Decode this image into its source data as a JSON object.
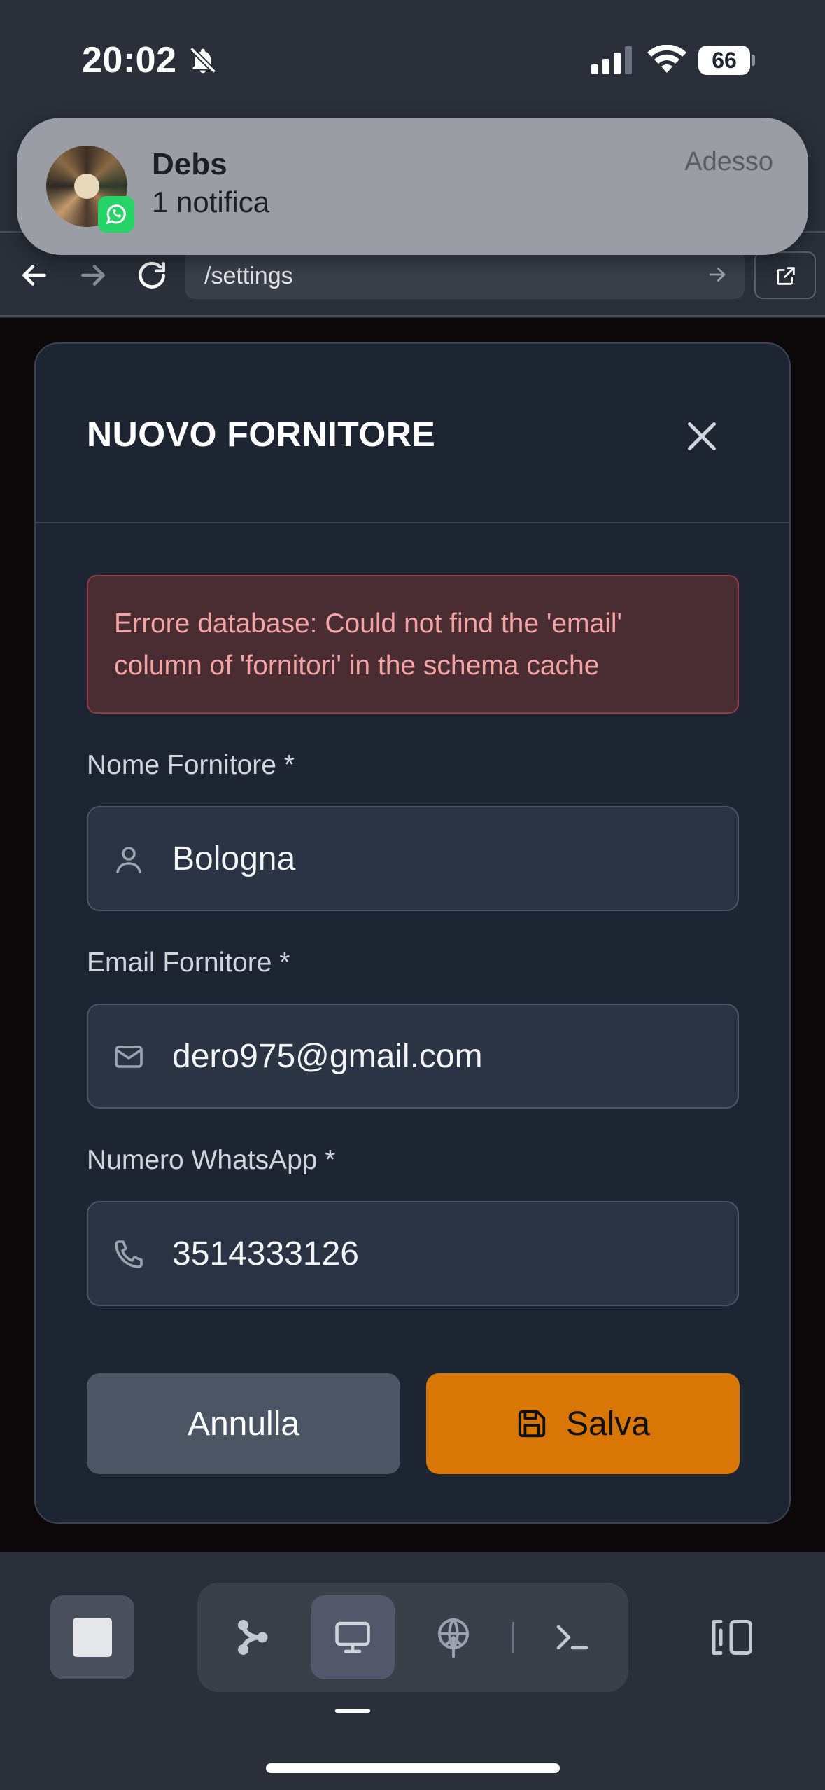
{
  "status_bar": {
    "time": "20:02",
    "battery": "66"
  },
  "notification": {
    "app_icon": "whatsapp-icon",
    "title": "Debs",
    "body": "1 notifica",
    "time": "Adesso"
  },
  "browser": {
    "url": "/settings"
  },
  "modal": {
    "title": "NUOVO FORNITORE",
    "error": "Errore database: Could not find the 'email' column of 'fornitori' in the schema cache",
    "fields": [
      {
        "label": "Nome Fornitore *",
        "value": "Bologna",
        "icon": "user-icon"
      },
      {
        "label": "Email Fornitore *",
        "value": "dero975@gmail.com",
        "icon": "mail-icon"
      },
      {
        "label": "Numero WhatsApp *",
        "value": "3514333126",
        "icon": "phone-icon"
      }
    ],
    "cancel_label": "Annulla",
    "save_label": "Salva"
  },
  "colors": {
    "accent": "#d97706",
    "error_text": "#f3a3a3",
    "modal_bg": "#1e2532"
  }
}
